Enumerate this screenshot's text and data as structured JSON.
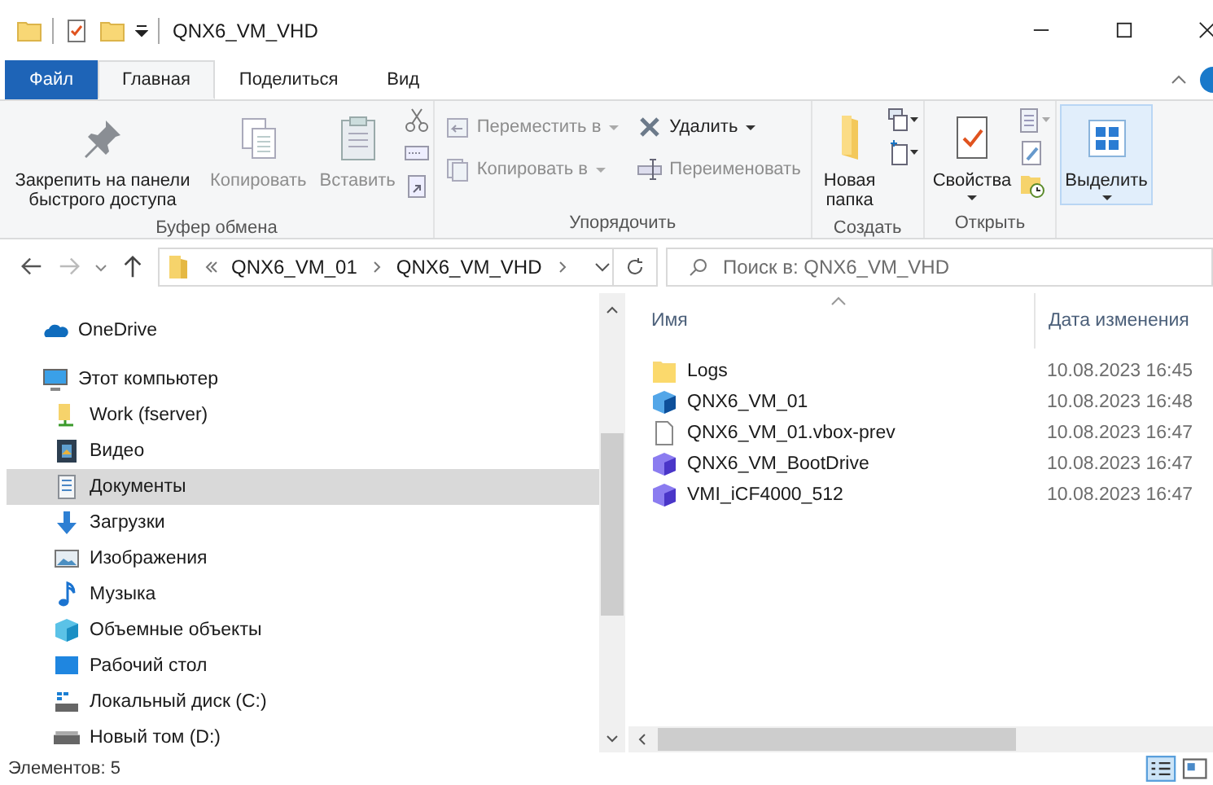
{
  "window": {
    "title": "QNX6_VM_VHD"
  },
  "ribbon_tabs": [
    {
      "label": "Файл",
      "kind": "file",
      "selected": false
    },
    {
      "label": "Главная",
      "kind": "tab",
      "selected": true
    },
    {
      "label": "Поделиться",
      "kind": "tab",
      "selected": false
    },
    {
      "label": "Вид",
      "kind": "tab",
      "selected": false
    }
  ],
  "ribbon": {
    "clipboard": {
      "label": "Буфер обмена",
      "pin": {
        "label": "Закрепить на панели быстрого доступа",
        "disabled": false
      },
      "copy": {
        "label": "Копировать",
        "disabled": true
      },
      "paste": {
        "label": "Вставить",
        "disabled": true
      }
    },
    "organize": {
      "label": "Упорядочить",
      "move": {
        "label": "Переместить в",
        "disabled": true
      },
      "copy_to": {
        "label": "Копировать в",
        "disabled": true
      },
      "delete": {
        "label": "Удалить",
        "disabled": false
      },
      "rename": {
        "label": "Переименовать",
        "disabled": true
      }
    },
    "create": {
      "label": "Создать",
      "new_folder": {
        "label": "Новая папка",
        "disabled": false
      }
    },
    "open": {
      "label": "Открыть",
      "properties": {
        "label": "Свойства",
        "disabled": false
      }
    },
    "select": {
      "label": "Выделить",
      "highlighted": true
    }
  },
  "address": {
    "crumbs": [
      "QNX6_VM_01",
      "QNX6_VM_VHD"
    ]
  },
  "search": {
    "placeholder": "Поиск в: QNX6_VM_VHD"
  },
  "sidebar": {
    "items": [
      {
        "label": "OneDrive",
        "kind": "cloud",
        "selected": false
      },
      {
        "label": "Этот компьютер",
        "kind": "computer",
        "selected": false,
        "children": [
          {
            "label": "Work (fserver)",
            "kind": "network",
            "selected": false
          },
          {
            "label": "Видео",
            "kind": "video",
            "selected": false
          },
          {
            "label": "Документы",
            "kind": "documents",
            "selected": true
          },
          {
            "label": "Загрузки",
            "kind": "downloads",
            "selected": false
          },
          {
            "label": "Изображения",
            "kind": "pictures",
            "selected": false
          },
          {
            "label": "Музыка",
            "kind": "music",
            "selected": false
          },
          {
            "label": "Объемные объекты",
            "kind": "objects3d",
            "selected": false
          },
          {
            "label": "Рабочий стол",
            "kind": "desktop",
            "selected": false
          },
          {
            "label": "Локальный диск (C:)",
            "kind": "system-disk",
            "selected": false
          },
          {
            "label": "Новый том (D:)",
            "kind": "disk",
            "selected": false
          }
        ]
      }
    ]
  },
  "files": {
    "columns": [
      "Имя",
      "Дата изменения"
    ],
    "rows": [
      {
        "name": "Logs",
        "date": "10.08.2023 16:45",
        "kind": "folder"
      },
      {
        "name": "QNX6_VM_01",
        "date": "10.08.2023 16:48",
        "kind": "vm"
      },
      {
        "name": "QNX6_VM_01.vbox-prev",
        "date": "10.08.2023 16:47",
        "kind": "file"
      },
      {
        "name": "QNX6_VM_BootDrive",
        "date": "10.08.2023 16:47",
        "kind": "disk"
      },
      {
        "name": "VMI_iCF4000_512",
        "date": "10.08.2023 16:47",
        "kind": "disk"
      }
    ]
  },
  "status_bar": {
    "count": "Элементов: 5"
  }
}
